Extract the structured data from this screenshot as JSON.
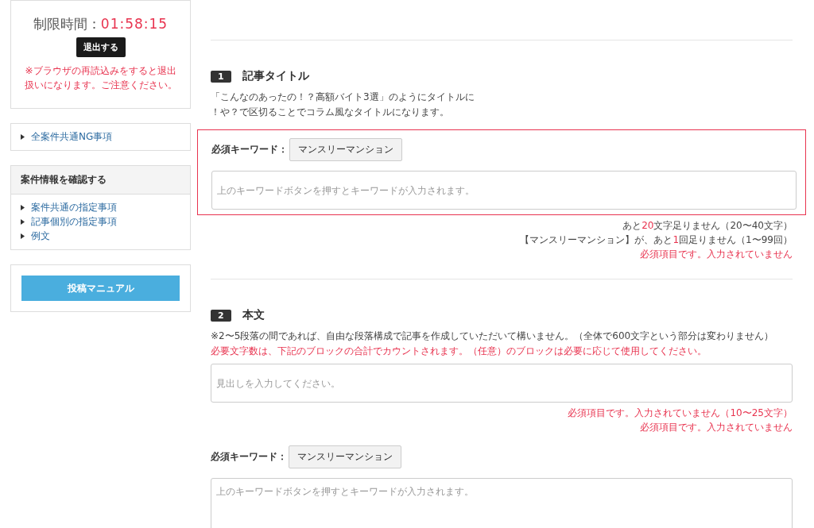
{
  "timer": {
    "label": "制限時間：",
    "value": "01:58:15",
    "exit_button": "退出する",
    "warning": "※ブラウザの再読込みをすると退出扱いになります。ご注意ください。"
  },
  "ng_links": [
    {
      "label": "全案件共通NG事項"
    }
  ],
  "info_panel": {
    "title": "案件情報を確認する",
    "links": [
      {
        "label": "案件共通の指定事項"
      },
      {
        "label": "記事個別の指定事項"
      },
      {
        "label": "例文"
      }
    ]
  },
  "manual_button": "投稿マニュアル",
  "sections": [
    {
      "number": "1",
      "title": "記事タイトル",
      "description": [
        {
          "text": "「こんなのあったの！？高額バイト3選」のようにタイトルに",
          "warning": false
        },
        {
          "text": "！や？で区切ることでコラム風なタイトルになります。",
          "warning": false
        }
      ],
      "blocks": [
        {
          "kind": "keyword",
          "invalid": true,
          "keyword_label": "必須キーワード：",
          "keyword_button": "マンスリーマンション",
          "placeholder": "上のキーワードボタンを押すとキーワードが入力されます。",
          "notes": [
            {
              "parts": [
                {
                  "text": "あと",
                  "accent": false
                },
                {
                  "text": "20",
                  "accent": true
                },
                {
                  "text": "文字足りません（20〜40文字）",
                  "accent": false
                }
              ]
            },
            {
              "parts": [
                {
                  "text": "【マンスリーマンション】が、あと",
                  "accent": false
                },
                {
                  "text": "1",
                  "accent": true
                },
                {
                  "text": "回足りません（1〜99回）",
                  "accent": false
                }
              ]
            },
            {
              "parts": [
                {
                  "text": "必須項目です。入力されていません",
                  "accent": true
                }
              ]
            }
          ]
        }
      ]
    },
    {
      "number": "2",
      "title": "本文",
      "description": [
        {
          "text": "※2〜5段落の間であれば、自由な段落構成で記事を作成していただいて構いません。（全体で600文字という部分は変わりません）",
          "warning": false
        },
        {
          "text": "必要文字数は、下記のブロックの合計でカウントされます。（任意）のブロックは必要に応じて使用してください。",
          "warning": true
        }
      ],
      "blocks": [
        {
          "kind": "heading",
          "invalid": false,
          "placeholder": "見出しを入力してください。",
          "notes": [
            {
              "parts": [
                {
                  "text": "必須項目です。入力されていません（10〜25文字）",
                  "accent": true
                }
              ]
            },
            {
              "parts": [
                {
                  "text": "必須項目です。入力されていません",
                  "accent": true
                }
              ]
            }
          ]
        },
        {
          "kind": "body",
          "invalid": false,
          "keyword_label": "必須キーワード：",
          "keyword_button": "マンスリーマンション",
          "placeholder": "上のキーワードボタンを押すとキーワードが入力されます。"
        }
      ]
    }
  ]
}
